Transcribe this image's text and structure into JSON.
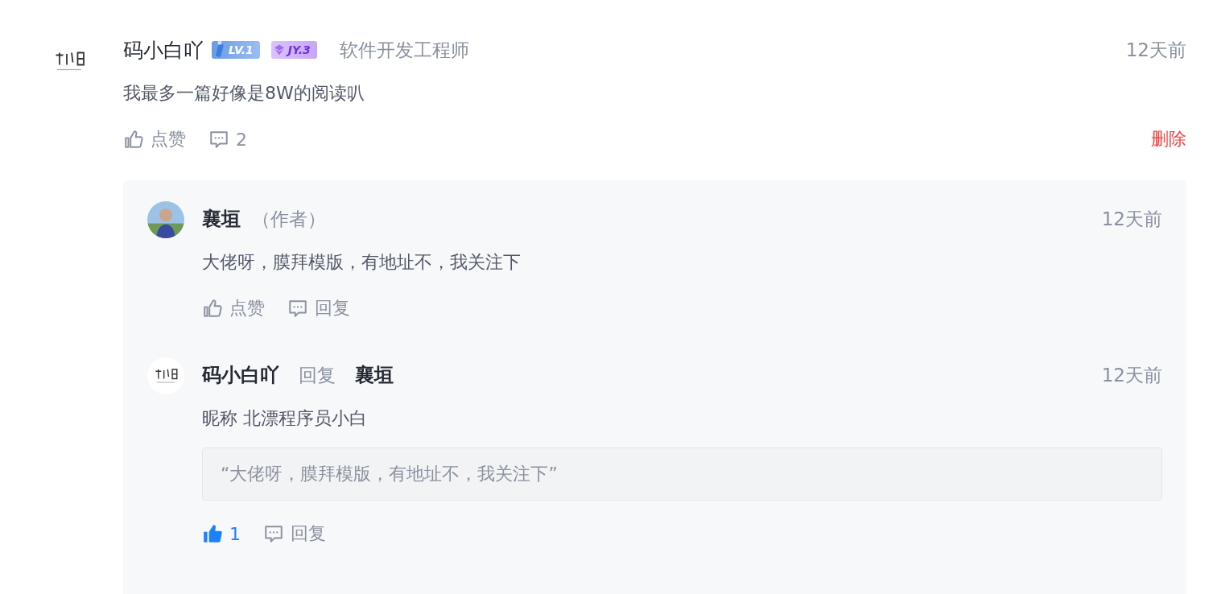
{
  "comment": {
    "avatar": {
      "kind": "logo"
    },
    "name": "码小白吖",
    "badges": [
      {
        "kind": "level",
        "label": "LV.1"
      },
      {
        "kind": "jy",
        "label": "JY.3"
      }
    ],
    "title": "软件开发工程师",
    "time": "12天前",
    "text": "我最多一篇好像是8W的阅读叭",
    "like": {
      "label": "点赞",
      "liked": false
    },
    "comment_count": "2",
    "delete": "删除",
    "replies": [
      {
        "avatar": {
          "kind": "person"
        },
        "name": "襄垣",
        "role": "（作者）",
        "time": "12天前",
        "text": "大佬呀，膜拜模版，有地址不，我关注下",
        "like": {
          "label": "点赞",
          "liked": false
        },
        "reply": "回复"
      },
      {
        "avatar": {
          "kind": "logo"
        },
        "name": "码小白吖",
        "reply_word": "回复",
        "reply_to": "襄垣",
        "time": "12天前",
        "text": "昵称 北漂程序员小白",
        "quote": "“大佬呀，膜拜模版，有地址不，我关注下”",
        "like": {
          "label": "1",
          "liked": true
        },
        "reply": "回复"
      }
    ]
  }
}
